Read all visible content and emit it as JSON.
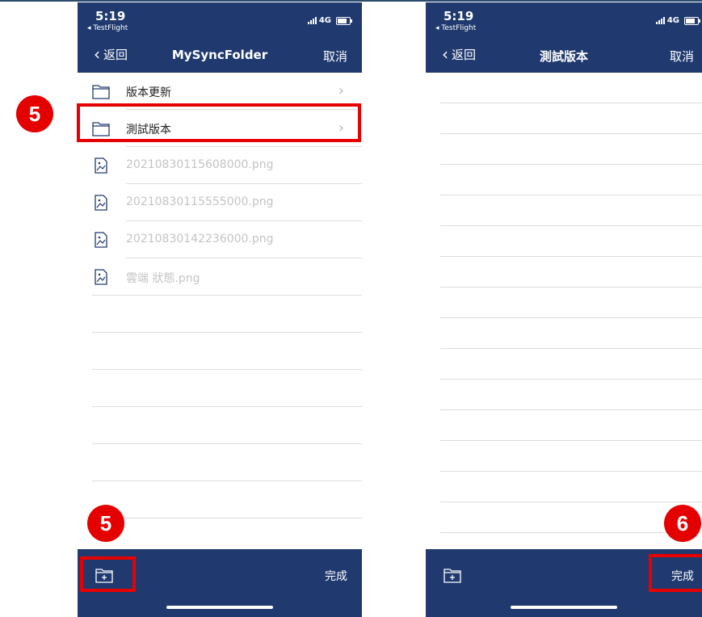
{
  "left_screen": {
    "status_time": "5:19",
    "status_back_app": "◂ TestFlight",
    "network": "4G",
    "nav_back": "返回",
    "nav_title": "MySyncFolder",
    "nav_cancel": "取消",
    "items": [
      {
        "label": "版本更新",
        "type": "folder"
      },
      {
        "label": "測試版本",
        "type": "folder"
      },
      {
        "label": "20210830115608000.png",
        "type": "image"
      },
      {
        "label": "20210830115555000.png",
        "type": "image"
      },
      {
        "label": "20210830142236000.png",
        "type": "image"
      },
      {
        "label": "雲端 狀態.png",
        "type": "image"
      }
    ],
    "footer_done": "完成"
  },
  "right_screen": {
    "status_time": "5:19",
    "status_back_app": "◂ TestFlight",
    "network": "4G",
    "nav_back": "返回",
    "nav_title": "測試版本",
    "nav_cancel": "取消",
    "footer_done": "完成"
  },
  "annotations": {
    "step_folder": "5",
    "step_new_folder": "5",
    "step_done": "6"
  },
  "colors": {
    "header_bg": "#203a70",
    "highlight": "#e60000"
  }
}
